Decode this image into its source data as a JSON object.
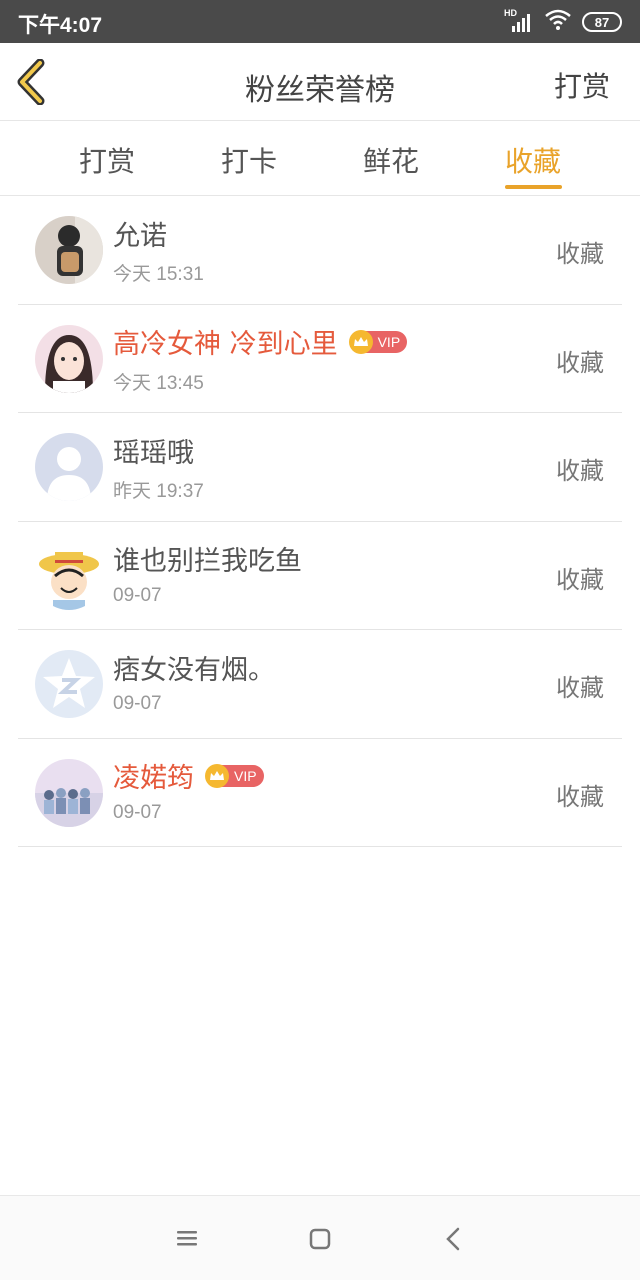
{
  "status_bar": {
    "time": "下午4:07",
    "battery": "87",
    "network": "HD"
  },
  "header": {
    "title": "粉丝荣誉榜",
    "action_label": "打赏",
    "back_icon": "chevron-left-icon"
  },
  "tabs": [
    {
      "label": "打赏",
      "active": false
    },
    {
      "label": "打卡",
      "active": false
    },
    {
      "label": "鲜花",
      "active": false
    },
    {
      "label": "收藏",
      "active": true
    }
  ],
  "colors": {
    "accent": "#e9a32a",
    "vip_name": "#e55a3c",
    "vip_badge": "#e86464"
  },
  "fans": [
    {
      "name": "允诺",
      "time": "今天 15:31",
      "action": "收藏",
      "vip": false
    },
    {
      "name": "高冷女神 冷到心里",
      "time": "今天 13:45",
      "action": "收藏",
      "vip": true,
      "vip_label": "VIP"
    },
    {
      "name": "瑶瑶哦",
      "time": "昨天 19:37",
      "action": "收藏",
      "vip": false
    },
    {
      "name": "谁也别拦我吃鱼",
      "time": "09-07",
      "action": "收藏",
      "vip": false
    },
    {
      "name": "痞女没有烟。",
      "time": "09-07",
      "action": "收藏",
      "vip": false
    },
    {
      "name": "凌婼筠",
      "time": "09-07",
      "action": "收藏",
      "vip": true,
      "vip_label": "VIP"
    }
  ]
}
